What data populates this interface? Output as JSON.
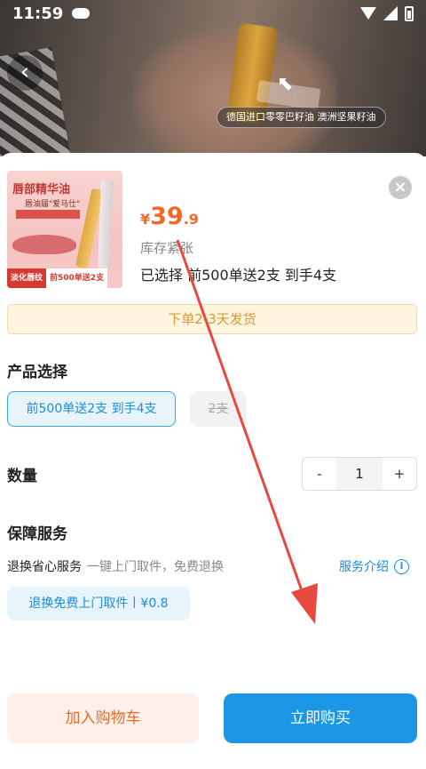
{
  "status_bar": {
    "time": "11:59"
  },
  "video": {
    "caption": "德国进口零零巴籽油 澳洲坚果籽油"
  },
  "product": {
    "thumb_title": "唇部精华油",
    "thumb_sub": "唇油届\"爱马仕\"",
    "thumb_badge_left": "淡化唇纹",
    "thumb_badge_right": "前500单送2支",
    "price_symbol": "¥",
    "price_int": "39",
    "price_dec": ".9",
    "stock": "库存紧张",
    "selected": "已选择 前500单送2支  到手4支"
  },
  "shipping_banner": "下单2-3天发货",
  "product_select": {
    "title": "产品选择",
    "options": [
      {
        "label": "前500单送2支  到手4支",
        "selected": true
      },
      {
        "label": "2支",
        "selected": false
      }
    ]
  },
  "quantity": {
    "title": "数量",
    "minus": "-",
    "value": "1",
    "plus": "+"
  },
  "service": {
    "title": "保障服务",
    "name": "退换省心服务",
    "desc": "一键上门取件，免费退换",
    "link": "服务介绍",
    "tag": "退换免费上门取件丨¥0.8"
  },
  "actions": {
    "add_to_cart": "加入购物车",
    "buy_now": "立即购买"
  },
  "colors": {
    "accent_blue": "#1b97e5",
    "price_orange": "#ee6a2a",
    "annotation_red": "#e8493f"
  }
}
